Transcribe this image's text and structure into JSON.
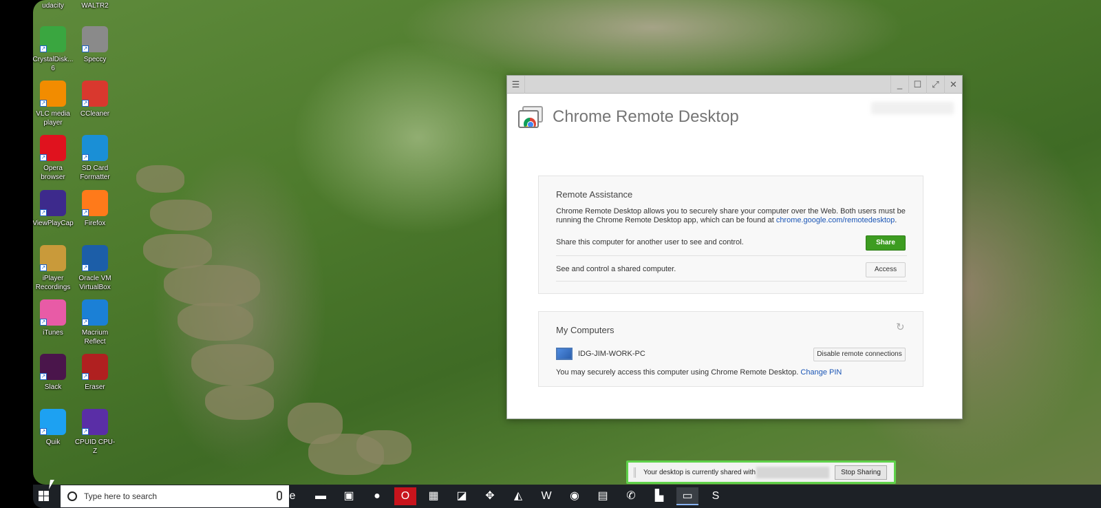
{
  "desktop": {
    "icons": [
      {
        "label": "udacity",
        "icon": "audacity-icon",
        "color": "#f26b1d"
      },
      {
        "label": "WALTR2",
        "icon": "waltr-icon",
        "color": "#888888"
      },
      {
        "label": "CrystalDisk... 6",
        "icon": "crystaldisk-icon",
        "color": "#3aa640"
      },
      {
        "label": "Speccy",
        "icon": "speccy-icon",
        "color": "#8a8a8a"
      },
      {
        "label": "VLC media player",
        "icon": "vlc-icon",
        "color": "#f28c00"
      },
      {
        "label": "CCleaner",
        "icon": "ccleaner-icon",
        "color": "#d9382e"
      },
      {
        "label": "Opera browser",
        "icon": "opera-icon",
        "color": "#e0121e"
      },
      {
        "label": "SD Card Formatter",
        "icon": "sd-card-icon",
        "color": "#1a8fd6"
      },
      {
        "label": "ViewPlayCap",
        "icon": "viewplaycap-icon",
        "color": "#3d2a8c"
      },
      {
        "label": "Firefox",
        "icon": "firefox-icon",
        "color": "#ff7a1a"
      },
      {
        "label": "iPlayer Recordings",
        "icon": "folder-icon",
        "color": "#c99a3a"
      },
      {
        "label": "Oracle VM VirtualBox",
        "icon": "virtualbox-icon",
        "color": "#1c5ea8"
      },
      {
        "label": "iTunes",
        "icon": "itunes-icon",
        "color": "#e85ba6"
      },
      {
        "label": "Macrium Reflect",
        "icon": "macrium-icon",
        "color": "#1b80d6"
      },
      {
        "label": "Slack",
        "icon": "slack-icon",
        "color": "#4a154b"
      },
      {
        "label": "Eraser",
        "icon": "eraser-icon",
        "color": "#b02020"
      },
      {
        "label": "Quik",
        "icon": "quik-icon",
        "color": "#1da1f2"
      },
      {
        "label": "CPUID CPU-Z",
        "icon": "cpuz-icon",
        "color": "#5a2ea6"
      }
    ]
  },
  "window": {
    "app_title": "Chrome Remote Desktop",
    "controls": [
      "menu-icon",
      "minimize-icon",
      "maximize-icon",
      "fullscreen-icon",
      "close-icon"
    ]
  },
  "remote_assistance": {
    "heading": "Remote Assistance",
    "description": "Chrome Remote Desktop allows you to securely share your computer over the Web. Both users must be running the Chrome Remote Desktop app, which can be found at ",
    "link": "chrome.google.com/remotedesktop",
    "description_end": ".",
    "share_text": "Share this computer for another user to see and control.",
    "share_button": "Share",
    "access_text": "See and control a shared computer.",
    "access_button": "Access",
    "share_color": "#3d9c21"
  },
  "my_computers": {
    "heading": "My Computers",
    "computer_name": "IDG-JIM-WORK-PC",
    "disable_button": "Disable remote connections",
    "note": "You may securely access this computer using Chrome Remote Desktop. ",
    "change_pin": "Change PIN"
  },
  "share_bar": {
    "text": "Your desktop is currently shared with",
    "stop_button": "Stop Sharing",
    "border_color": "#5fd14a"
  },
  "taskbar": {
    "search_placeholder": "Type here to search",
    "apps": [
      {
        "icon": "task-view-icon",
        "glyph": "⧉",
        "color": "#1d2126"
      },
      {
        "icon": "edge-icon",
        "glyph": "e",
        "color": "#1d2126"
      },
      {
        "icon": "file-explorer-icon",
        "glyph": "▬",
        "color": "#1d2126"
      },
      {
        "icon": "store-icon",
        "glyph": "▣",
        "color": "#1d2126"
      },
      {
        "icon": "firefox-icon",
        "glyph": "●",
        "color": "#1d2126"
      },
      {
        "icon": "opera-icon",
        "glyph": "O",
        "color": "#c8141c"
      },
      {
        "icon": "photos-icon",
        "glyph": "▦",
        "color": "#1d2126"
      },
      {
        "icon": "notepad-icon",
        "glyph": "◪",
        "color": "#1d2126"
      },
      {
        "icon": "app-orange-icon",
        "glyph": "✥",
        "color": "#1d2126"
      },
      {
        "icon": "macrium-icon",
        "glyph": "◭",
        "color": "#1d2126"
      },
      {
        "icon": "word-icon",
        "glyph": "W",
        "color": "#1d2126"
      },
      {
        "icon": "chrome-icon",
        "glyph": "◉",
        "color": "#1d2126"
      },
      {
        "icon": "calculator-icon",
        "glyph": "▤",
        "color": "#1d2126"
      },
      {
        "icon": "whatsapp-icon",
        "glyph": "✆",
        "color": "#1d2126"
      },
      {
        "icon": "network-icon",
        "glyph": "▙",
        "color": "#1d2126"
      },
      {
        "icon": "chrome-remote-desktop-icon",
        "glyph": "▭",
        "color": "#3a3f45"
      },
      {
        "icon": "skitch-icon",
        "glyph": "S",
        "color": "#1d2126"
      }
    ]
  }
}
